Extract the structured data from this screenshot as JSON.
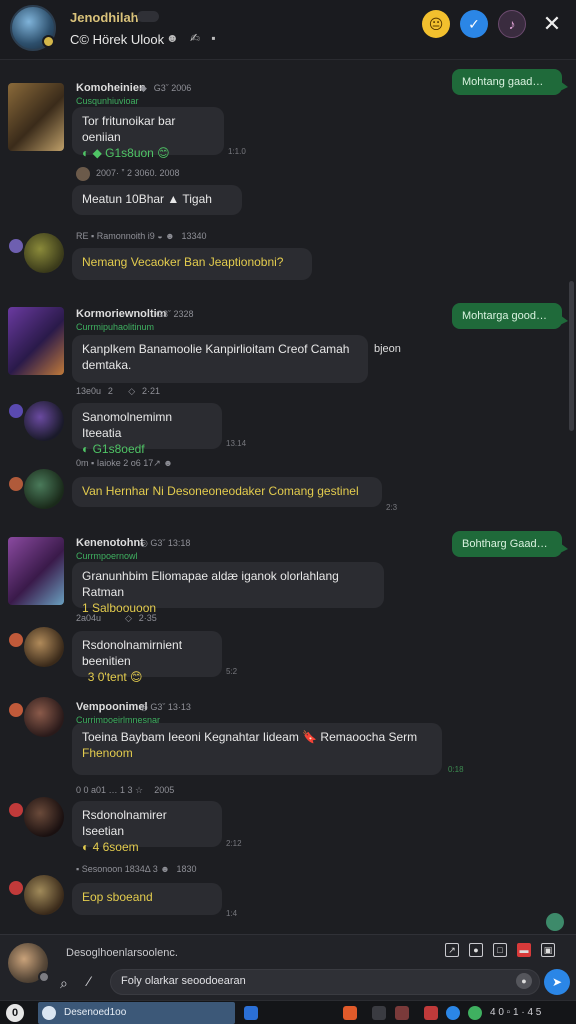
{
  "header": {
    "name": "Jenodhilah",
    "subtitle": "C© Hörek Ulook",
    "subtitle_icons": "☻ ✍ ▪",
    "buttons": {
      "emoji": "😐",
      "call": "✓",
      "audio": "♪",
      "close": "✕"
    }
  },
  "messages": [
    {
      "sender": "Komoheinien",
      "meta": "◆   G3ˇ  2006",
      "sub": "Cusqunhiuvioar",
      "text": "Tor fritunoikar bar oeniian",
      "line2": "◐  ◆ G1s8uon 😊",
      "time": "1:1.0"
    },
    {
      "meta": "2007· ˮ  2 3060. 2008",
      "text": "Meatun  10Bhar ▲ Tigah"
    },
    {
      "meta": "RE ▪ Ramonnoith i9 ◒ ☻   13340",
      "text": "Nemang Vecaoker Ban Jeaptionobni?"
    },
    {
      "sender": "Kormoriewnoltim",
      "meta": "G3ˇ  2328",
      "sub": "Currmipuhaolitinum",
      "text": "Kanplkem Banamoolie Kanpirlioitam Creof Camah",
      "text_b": "demtaka.",
      "tail": "bjeon",
      "meta2": "13e0u   2       ◇   2·21"
    },
    {
      "text": "Sanomolnemimn Iteeatia",
      "line2": "◐  G1s8oedf",
      "time": "13.14"
    },
    {
      "meta": "0m ▪ Iaioke 2  o6 17↗ ☻",
      "text": "Van Hernhar  Ni Desoneoneodaker Comang gestinel",
      "time": "2:3"
    },
    {
      "sender": "Kenenotohnt",
      "meta": "◎  G3ˇ  13:18",
      "sub": "Currmpoernowl",
      "text": "Granunhbim Eliomapae aldæ iganok olorlahlang Ratman",
      "line2": "1 Salboouoon",
      "meta2": "2a04u           ◇   2·35"
    },
    {
      "text": "Rsdonolnamirnient beenitien",
      "line2": "  3 0'tent 😊",
      "time": "5:2"
    },
    {
      "sender": "Vempoonimel",
      "meta": "◎  G3ˇ  13·13",
      "sub": "Currimpoeirlmnesnar",
      "text": "Toeina Baybam Ieeoni Kegnahtar Iideam 🔖 Remaoocha Serm",
      "line2": "Fhenoom",
      "time": "0:18"
    },
    {
      "meta": "0 0 a01 … 1 3 ☆     2005",
      "text": "Rsdonolnamirer Iseetian",
      "line2": "◐  4 6soem",
      "time": "2:12"
    },
    {
      "meta": "▪ Sesonoon 1834Δ 3 ☻   1830",
      "text": "Eop sboeand",
      "time": "1:4"
    }
  ],
  "outgoing": [
    {
      "text": "Mohtang gaad…"
    },
    {
      "text": "Mohtarga good…"
    },
    {
      "text": "Bohtharg Gaad…"
    }
  ],
  "composer": {
    "hint": "Desoglhoenlarsoolenc.",
    "placeholder": "Foly olarkar seoodoearan",
    "tools": [
      "↗",
      "●",
      "□",
      "▬",
      "▣"
    ]
  },
  "taskbar": {
    "task_label": "Desenoed1oo",
    "right_label": "4 0  ▫ 1 · 4 5"
  }
}
